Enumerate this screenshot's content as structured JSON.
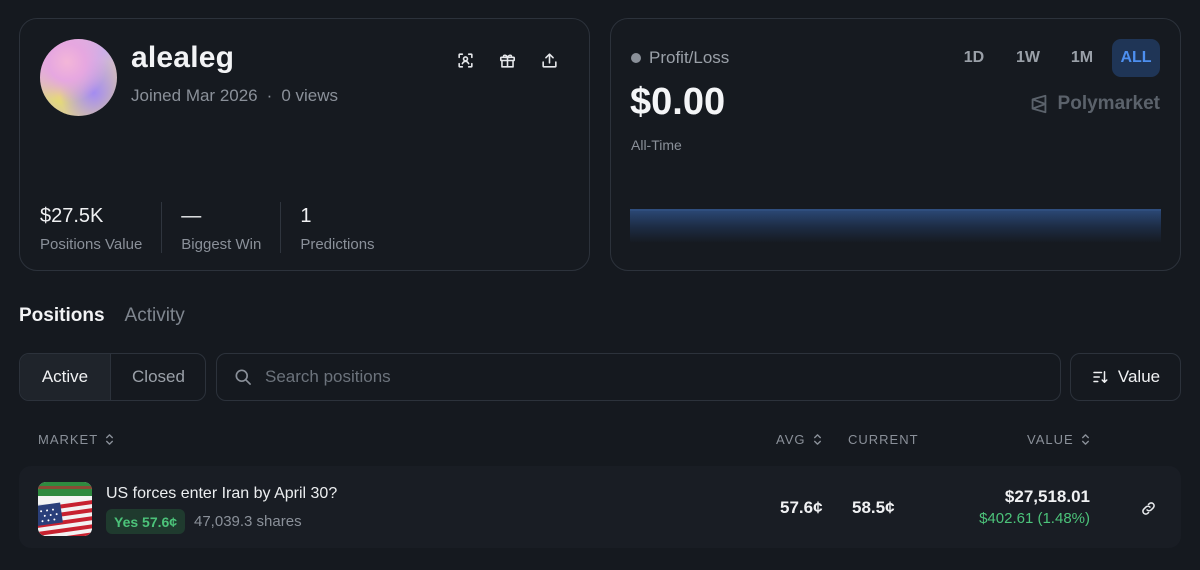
{
  "profile": {
    "username": "alealeg",
    "joined": "Joined Mar 2026",
    "separator": "·",
    "views": "0 views",
    "actions": [
      "scan-icon",
      "gift-icon",
      "share-icon"
    ],
    "stats": [
      {
        "value": "$27.5K",
        "label": "Positions Value"
      },
      {
        "value": "—",
        "label": "Biggest Win"
      },
      {
        "value": "1",
        "label": "Predictions"
      }
    ]
  },
  "pnl": {
    "label": "Profit/Loss",
    "amount": "$0.00",
    "period_label": "All-Time",
    "brand": "Polymarket",
    "ranges": [
      "1D",
      "1W",
      "1M",
      "ALL"
    ],
    "active_range": "ALL"
  },
  "tabs": [
    {
      "label": "Positions",
      "active": true
    },
    {
      "label": "Activity",
      "active": false
    }
  ],
  "filters": {
    "active_label": "Active",
    "closed_label": "Closed",
    "search_placeholder": "Search positions",
    "sort_label": "Value"
  },
  "table": {
    "headers": {
      "market": "MARKET",
      "avg": "AVG",
      "current": "CURRENT",
      "value": "VALUE"
    },
    "rows": [
      {
        "title": "US forces enter Iran by April 30?",
        "outcome": "Yes 57.6¢",
        "shares": "47,039.3 shares",
        "avg": "57.6¢",
        "current": "58.5¢",
        "value": "$27,518.01",
        "change": "$402.61 (1.48%)"
      }
    ]
  },
  "colors": {
    "background": "#15191f",
    "accent": "#4d8ff0",
    "positive": "#4cc37a"
  }
}
